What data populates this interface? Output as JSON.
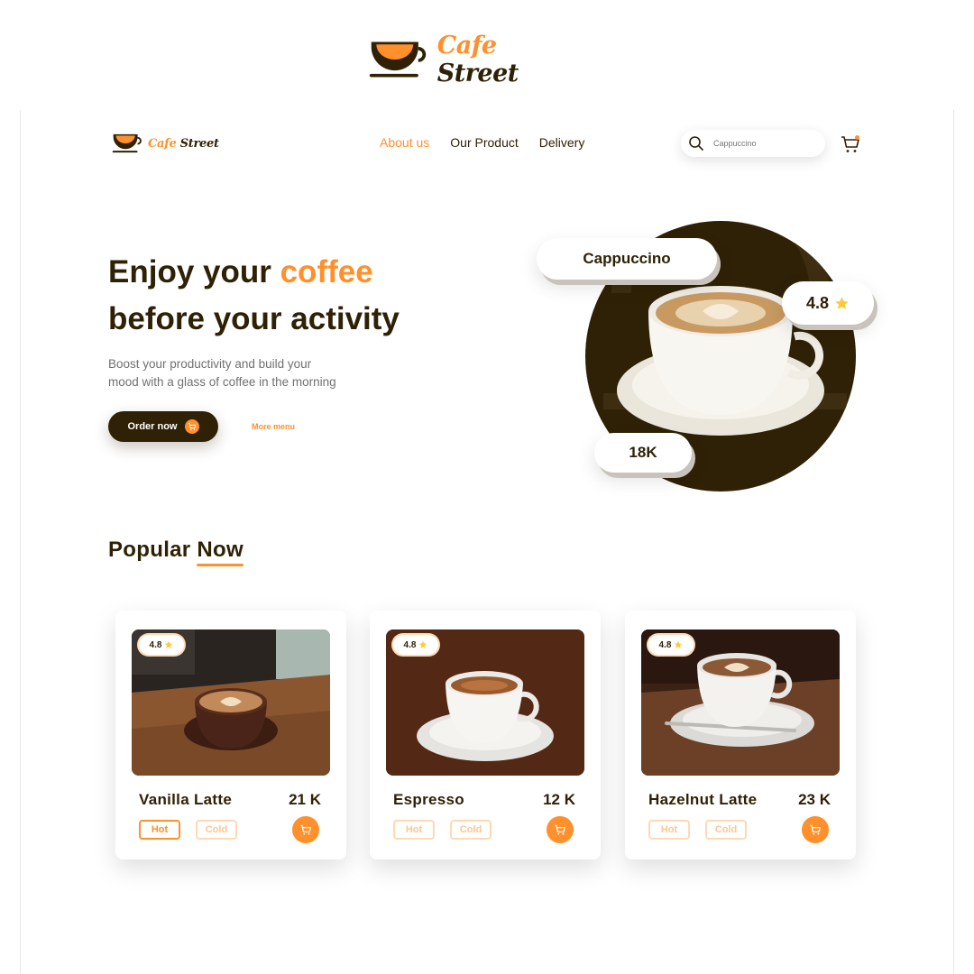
{
  "brand": {
    "word1": "Cafe",
    "word2": "Street"
  },
  "nav": {
    "links": [
      {
        "label": "About us",
        "active": true
      },
      {
        "label": "Our Product",
        "active": false
      },
      {
        "label": "Delivery",
        "active": false
      }
    ],
    "search_placeholder": "Cappuccino"
  },
  "hero": {
    "title_line1_prefix": "Enjoy your ",
    "title_line1_accent": "coffee",
    "title_line2": "before your activity",
    "subtitle_line1": "Boost your productivity and build your",
    "subtitle_line2": "mood with a glass of coffee in the morning",
    "order_button": "Order now",
    "more_menu": "More menu",
    "featured_name": "Cappuccino",
    "featured_rating": "4.8",
    "featured_count": "18K"
  },
  "popular": {
    "title_prefix": "Popular ",
    "title_underlined": "Now",
    "items": [
      {
        "name": "Vanilla Latte",
        "price": "21 K",
        "rating": "4.8",
        "hot_label": "Hot",
        "cold_label": "Cold",
        "selected": "Hot"
      },
      {
        "name": "Espresso",
        "price": "12 K",
        "rating": "4.8",
        "hot_label": "Hot",
        "cold_label": "Cold",
        "selected": "none"
      },
      {
        "name": "Hazelnut Latte",
        "price": "23 K",
        "rating": "4.8",
        "hot_label": "Hot",
        "cold_label": "Cold",
        "selected": "none"
      }
    ]
  },
  "colors": {
    "accent": "#ff902b",
    "dark": "#2f2105",
    "muted": "#707070"
  }
}
